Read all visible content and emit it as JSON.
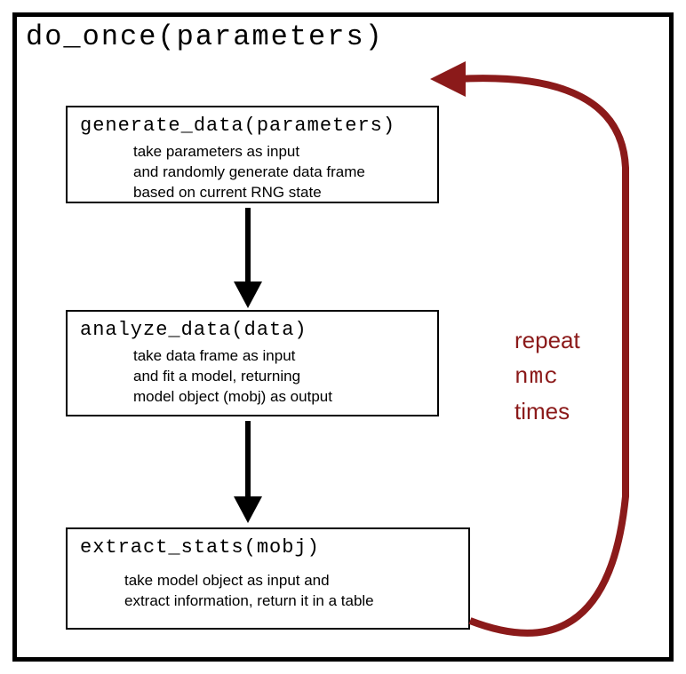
{
  "title": "do_once(parameters)",
  "steps": [
    {
      "fn": "generate_data(parameters)",
      "desc": "take parameters as input\nand randomly generate data frame\nbased on current RNG state"
    },
    {
      "fn": "analyze_data(data)",
      "desc": "take data frame as input\nand fit a model, returning\nmodel object (mobj) as output"
    },
    {
      "fn": "extract_stats(mobj)",
      "desc": "take model object as input and\nextract information, return it in a table"
    }
  ],
  "loop": {
    "word1": "repeat",
    "word2": "nmc",
    "word3": "times"
  }
}
